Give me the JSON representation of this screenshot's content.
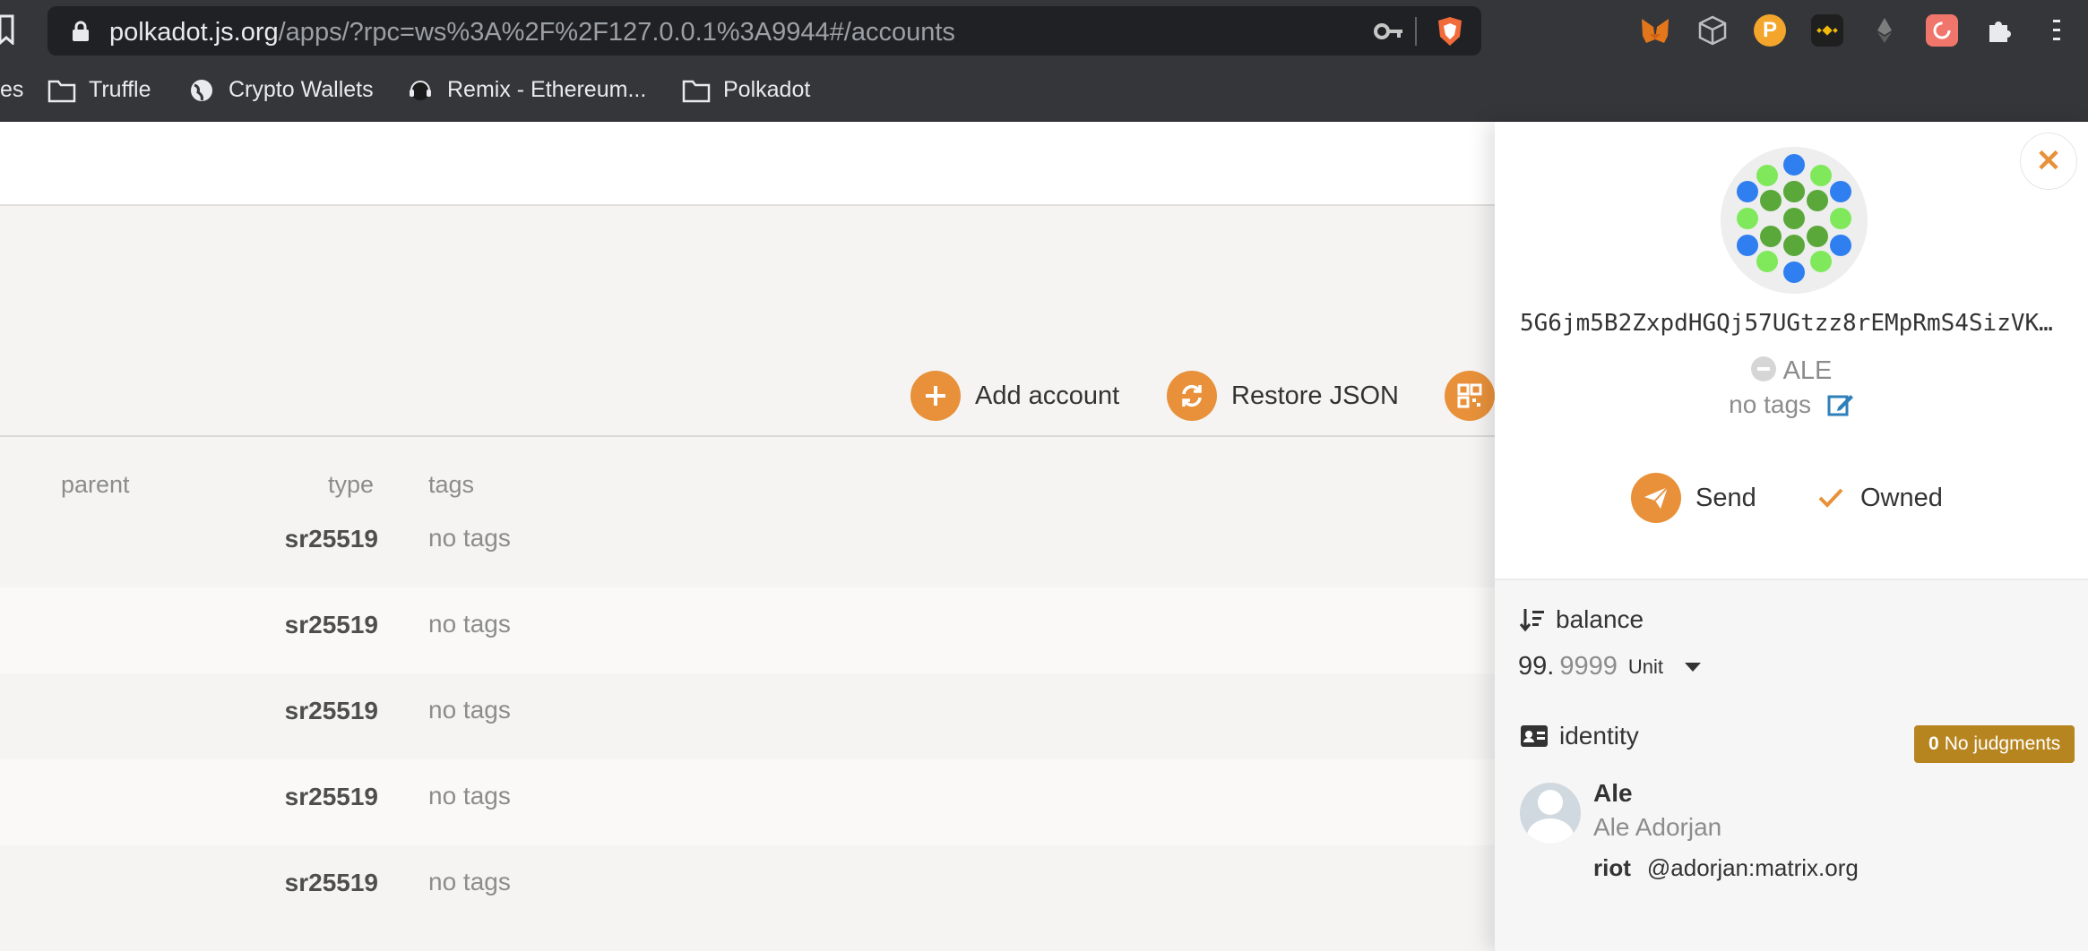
{
  "browser": {
    "url_host": "polkadot.js.org",
    "url_rest": "/apps/?rpc=ws%3A%2F%2F127.0.0.1%3A9944#/accounts",
    "bookmarks": [
      {
        "label": "es",
        "icon": "folder-icon"
      },
      {
        "label": "Truffle",
        "icon": "folder-icon"
      },
      {
        "label": "Crypto Wallets",
        "icon": "globe-icon"
      },
      {
        "label": "Remix - Ethereum...",
        "icon": "remix-icon"
      },
      {
        "label": "Polkadot",
        "icon": "folder-icon"
      }
    ],
    "extensions": [
      "metamask-icon",
      "cube-icon",
      "polkadot-ext-icon",
      "binance-icon",
      "ethereum-icon",
      "red-ext-icon",
      "puzzle-icon",
      "kebab-menu-icon"
    ]
  },
  "actions": {
    "add_account": "Add account",
    "restore_json": "Restore JSON"
  },
  "table": {
    "headers": {
      "parent": "parent",
      "type": "type",
      "tags": "tags"
    },
    "rows": [
      {
        "type": "sr25519",
        "tags": "no tags"
      },
      {
        "type": "sr25519",
        "tags": "no tags"
      },
      {
        "type": "sr25519",
        "tags": "no tags"
      },
      {
        "type": "sr25519",
        "tags": "no tags"
      },
      {
        "type": "sr25519",
        "tags": "no tags"
      }
    ]
  },
  "sidebar": {
    "address": "5G6jm5B2ZxpdHGQj57UGtzz8rEMpRmS4SizVK…",
    "name": "ALE",
    "tags": "no tags",
    "send": "Send",
    "owned": "Owned",
    "balance_label": "balance",
    "balance_int": "99.",
    "balance_dec": "9999",
    "balance_unit": "Unit",
    "identity_label": "identity",
    "judgments_count": "0",
    "judgments_label": "No judgments",
    "identity_name": "Ale",
    "identity_legal": "Ale Adorjan",
    "riot_label": "riot",
    "riot_value": "@adorjan:matrix.org"
  },
  "colors": {
    "accent": "#e8913a",
    "badge": "#b7851f"
  }
}
